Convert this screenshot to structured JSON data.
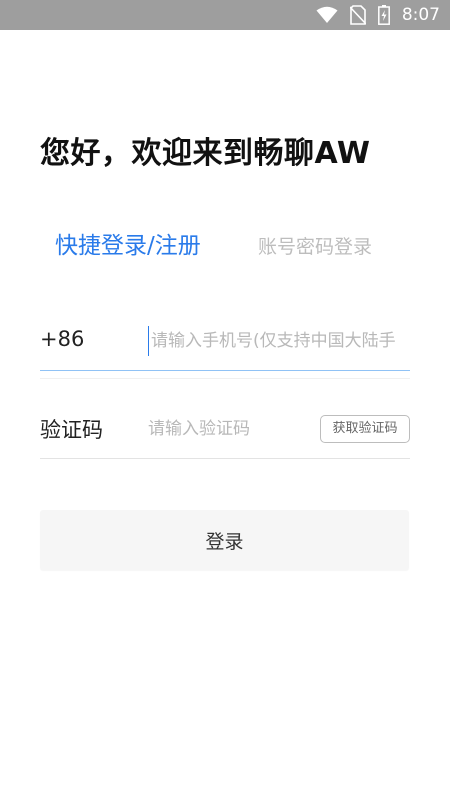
{
  "status_bar": {
    "time": "8:07",
    "icons": [
      "wifi-icon",
      "no-sim-icon",
      "battery-charging-icon"
    ],
    "background_color": "#9e9e9e"
  },
  "greeting": "您好，欢迎来到畅聊AW",
  "tabs": {
    "active": "快捷登录/注册",
    "inactive": "账号密码登录"
  },
  "phone": {
    "country_code": "+86",
    "placeholder": "请输入手机号(仅支持中国大陆手",
    "value": ""
  },
  "verification": {
    "label": "验证码",
    "placeholder": "请输入验证码",
    "value": "",
    "get_code_label": "获取验证码"
  },
  "login_button_label": "登录",
  "colors": {
    "accent": "#2a7bea",
    "inactive_tab": "#bdbdbd",
    "button_bg": "#f6f6f6"
  }
}
